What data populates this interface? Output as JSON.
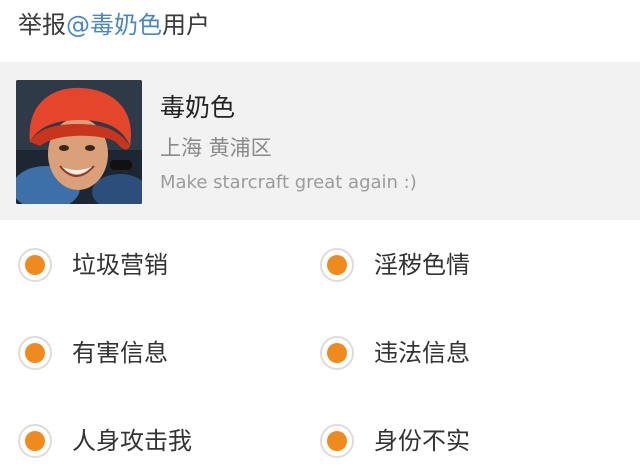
{
  "header": {
    "prefix": "举报",
    "mention": "@毒奶色",
    "suffix": "用户"
  },
  "profile": {
    "name": "毒奶色",
    "location": "上海 黄浦区",
    "bio": "Make starcraft great again :)"
  },
  "colors": {
    "accent": "#f08a1c",
    "mention": "#4a86c5",
    "card_background": "#f2f2f2"
  },
  "options": [
    {
      "label": "垃圾营销",
      "selected": true
    },
    {
      "label": "淫秽色情",
      "selected": true
    },
    {
      "label": "有害信息",
      "selected": true
    },
    {
      "label": "违法信息",
      "selected": true
    },
    {
      "label": "人身攻击我",
      "selected": true
    },
    {
      "label": "身份不实",
      "selected": true
    }
  ]
}
